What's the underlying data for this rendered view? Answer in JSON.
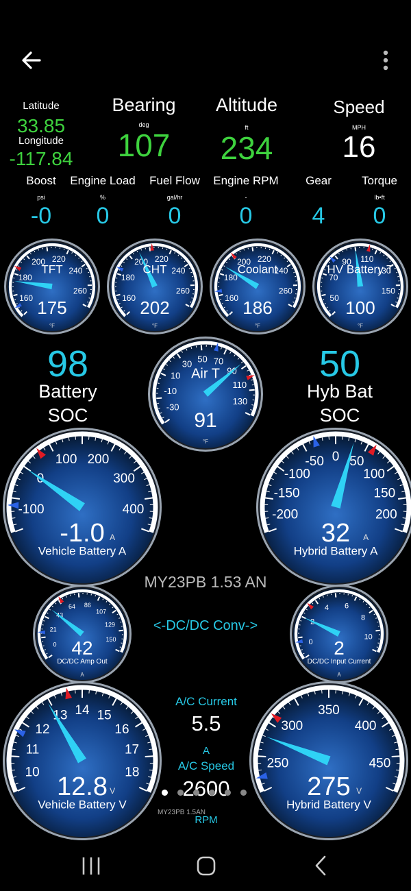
{
  "header": {
    "back_icon": "arrow-left-icon",
    "menu_icon": "more-vert-icon"
  },
  "readouts": {
    "latitude_label": "Latitude",
    "latitude_value": "33.85",
    "longitude_label": "Longitude",
    "longitude_value": "-117.84",
    "bearing_label": "Bearing",
    "bearing_unit": "deg",
    "bearing_value": "107",
    "altitude_label": "Altitude",
    "altitude_unit": "ft",
    "altitude_value": "234",
    "speed_label": "Speed",
    "speed_unit": "MPH",
    "speed_value": "16"
  },
  "row2": [
    {
      "label": "Boost",
      "unit": "psi",
      "value": "-0"
    },
    {
      "label": "Engine Load",
      "unit": "%",
      "value": "0"
    },
    {
      "label": "Fuel Flow",
      "unit": "gal/hr",
      "value": "0"
    },
    {
      "label": "Engine RPM",
      "unit": "-",
      "value": "0"
    },
    {
      "label": "Gear",
      "unit": "",
      "value": "4"
    },
    {
      "label": "Torque",
      "unit": "lb•ft",
      "value": "0"
    }
  ],
  "gauges": {
    "tft": {
      "label": "TFT",
      "value": "175",
      "unit": "°F",
      "ticks": [
        "160",
        "180",
        "200",
        "220",
        "240",
        "260"
      ],
      "min": 150,
      "max": 270,
      "reading": 175
    },
    "cht": {
      "label": "CHT",
      "value": "202",
      "unit": "°F",
      "ticks": [
        "160",
        "180",
        "200",
        "220",
        "240",
        "260"
      ],
      "min": 150,
      "max": 270,
      "reading": 202
    },
    "coolant": {
      "label": "Coolant",
      "value": "186",
      "unit": "°F",
      "ticks": [
        "160",
        "180",
        "200",
        "220",
        "240",
        "260"
      ],
      "min": 150,
      "max": 270,
      "reading": 186
    },
    "hv_battery_t": {
      "label": "HV Battery T",
      "value": "100",
      "unit": "°F",
      "ticks": [
        "50",
        "70",
        "90",
        "110",
        "130",
        "150"
      ],
      "min": 40,
      "max": 160,
      "reading": 100
    },
    "air_t": {
      "label": "Air T",
      "value": "91",
      "unit": "°F",
      "ticks": [
        "-30",
        "-10",
        "10",
        "30",
        "50",
        "70",
        "90",
        "110",
        "130"
      ],
      "min": -40,
      "max": 140,
      "reading": 91
    },
    "vehicle_battery_a": {
      "label": "Vehicle Battery A",
      "value": "-1.0",
      "unit": "A",
      "ticks": [
        "-100",
        "0",
        "100",
        "200",
        "300",
        "400"
      ],
      "min": -150,
      "max": 450,
      "reading": -1.0
    },
    "hybrid_battery_a": {
      "label": "Hybrid Battery A",
      "value": "32",
      "unit": "A",
      "ticks": [
        "-200",
        "-150",
        "-100",
        "-50",
        "0",
        "50",
        "100",
        "150",
        "200"
      ],
      "min": -225,
      "max": 225,
      "reading": 32
    },
    "dcdc_amp_out": {
      "label": "DC/DC Amp Out",
      "value": "42",
      "unit": "A",
      "ticks": [
        "0",
        "21",
        "43",
        "64",
        "86",
        "107",
        "129",
        "150"
      ],
      "min": -10,
      "max": 160,
      "reading": 42
    },
    "dcdc_input_current": {
      "label": "DC/DC Input Current",
      "value": "2",
      "unit": "A",
      "ticks": [
        "0",
        "2",
        "4",
        "6",
        "8",
        "10"
      ],
      "min": -1,
      "max": 11,
      "reading": 2
    },
    "vehicle_battery_v": {
      "label": "Vehicle Battery V",
      "value": "12.8",
      "unit": "V",
      "ticks": [
        "10",
        "11",
        "12",
        "13",
        "14",
        "15",
        "16",
        "17",
        "18"
      ],
      "min": 9.5,
      "max": 18.5,
      "reading": 12.8
    },
    "hybrid_battery_v": {
      "label": "Hybrid Battery V",
      "value": "275",
      "unit": "V",
      "ticks": [
        "250",
        "300",
        "350",
        "400",
        "450"
      ],
      "min": 225,
      "max": 475,
      "reading": 275
    }
  },
  "battery_soc": {
    "value": "98",
    "label1": "Battery",
    "label2": "SOC"
  },
  "hyb_bat_soc": {
    "value": "50",
    "label1": "Hyb Bat",
    "label2": "SOC"
  },
  "profile_name": "MY23PB 1.53 AN",
  "dcdc_label": "<-DC/DC Conv->",
  "ac_current": {
    "label": "A/C Current",
    "value": "5.5",
    "unit": "A"
  },
  "ac_speed": {
    "label": "A/C Speed",
    "value": "2600",
    "unit": "RPM"
  },
  "watermark": "MY23PB 1.5AN",
  "pager": {
    "count": 6,
    "active": 0
  },
  "navbar": {
    "recents_icon": "recents-icon",
    "home_icon": "home-icon",
    "back_icon": "back-chevron-icon"
  },
  "colors": {
    "green": "#3ed23e",
    "cyan": "#27c9e6",
    "needle": "#2fd2f5",
    "red": "#e21b24",
    "blue": "#2b62e6"
  }
}
